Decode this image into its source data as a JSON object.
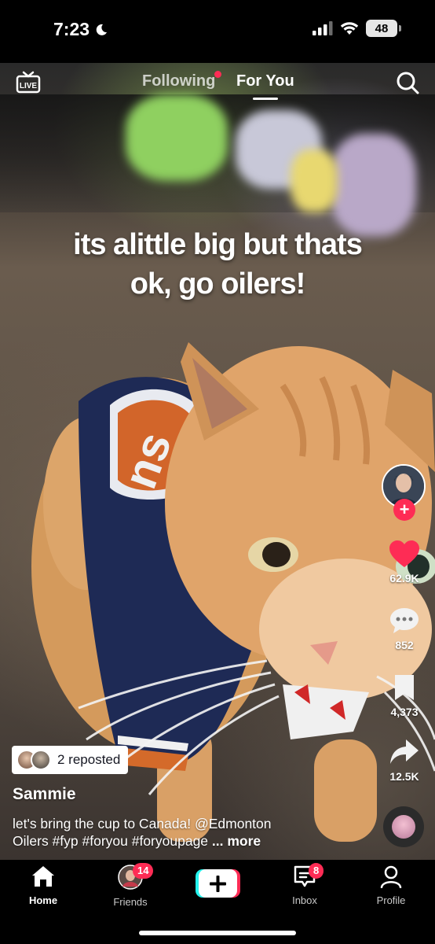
{
  "status_bar": {
    "time": "7:23",
    "battery": "48"
  },
  "top_nav": {
    "live_label": "LIVE",
    "tabs": [
      {
        "label": "Following",
        "has_dot": true
      },
      {
        "label": "For You",
        "active": true
      }
    ]
  },
  "video": {
    "caption_line1": "its alittle big but thats",
    "caption_line2": "ok, go oilers!"
  },
  "actions": {
    "likes": "62.9K",
    "comments": "852",
    "saves": "4,373",
    "shares": "12.5K",
    "like_color": "#fe2c55"
  },
  "post": {
    "reposted_label": "2 reposted",
    "username": "Sammie",
    "description_line1": "let's bring the cup to Canada! @Edmonton",
    "description_line2": "Oilers #fyp #foryou #foryoupage",
    "more_label": "... more"
  },
  "tab_bar": {
    "home": "Home",
    "friends": "Friends",
    "friends_badge": "14",
    "inbox": "Inbox",
    "inbox_badge": "8",
    "profile": "Profile"
  },
  "colors": {
    "accent": "#fe2c55",
    "create_left": "#25f4ee",
    "create_right": "#fe2c55"
  }
}
